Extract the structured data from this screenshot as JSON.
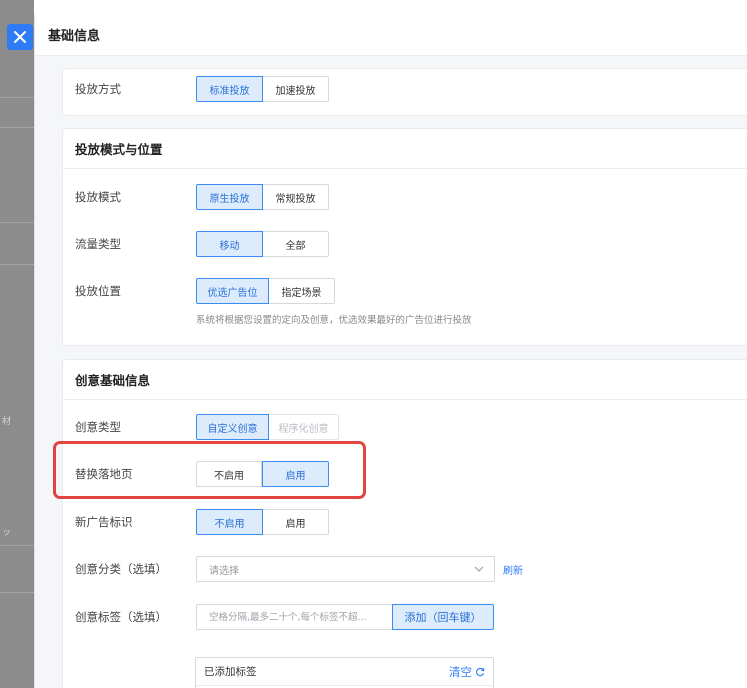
{
  "backdrop": {
    "text_a": "材",
    "text_b": "ッ"
  },
  "drawer": {
    "title": "基础信息"
  },
  "delivery": {
    "label": "投放方式",
    "options": [
      "标准投放",
      "加速投放"
    ]
  },
  "mode_section": {
    "title": "投放模式与位置",
    "mode": {
      "label": "投放模式",
      "options": [
        "原生投放",
        "常规投放"
      ]
    },
    "traffic": {
      "label": "流量类型",
      "options": [
        "移动",
        "全部"
      ]
    },
    "position": {
      "label": "投放位置",
      "options": [
        "优选广告位",
        "指定场景"
      ]
    },
    "hint": "系统将根据您设置的定向及创意，优选效果最好的广告位进行投放"
  },
  "creative_section": {
    "title": "创意基础信息",
    "type": {
      "label": "创意类型",
      "options": [
        "自定义创意",
        "程序化创意"
      ]
    },
    "landing": {
      "label": "替换落地页",
      "options": [
        "不启用",
        "启用"
      ]
    },
    "new_tag": {
      "label": "新广告标识",
      "options": [
        "不启用",
        "启用"
      ]
    },
    "category": {
      "label": "创意分类（选填）",
      "placeholder": "请选择",
      "refresh": "刷新"
    },
    "tags": {
      "label": "创意标签（选填）",
      "placeholder": "空格分隔,最多二十个,每个标签不超...",
      "add_button": "添加（回车键）",
      "added_title": "已添加标签",
      "clear": "清空"
    }
  },
  "colors": {
    "accent": "#2f7bf5",
    "highlight": "#e0463f"
  },
  "icons": {
    "close": "close-icon",
    "dropdown": "chevron-down-icon",
    "refresh": "refresh-icon"
  }
}
